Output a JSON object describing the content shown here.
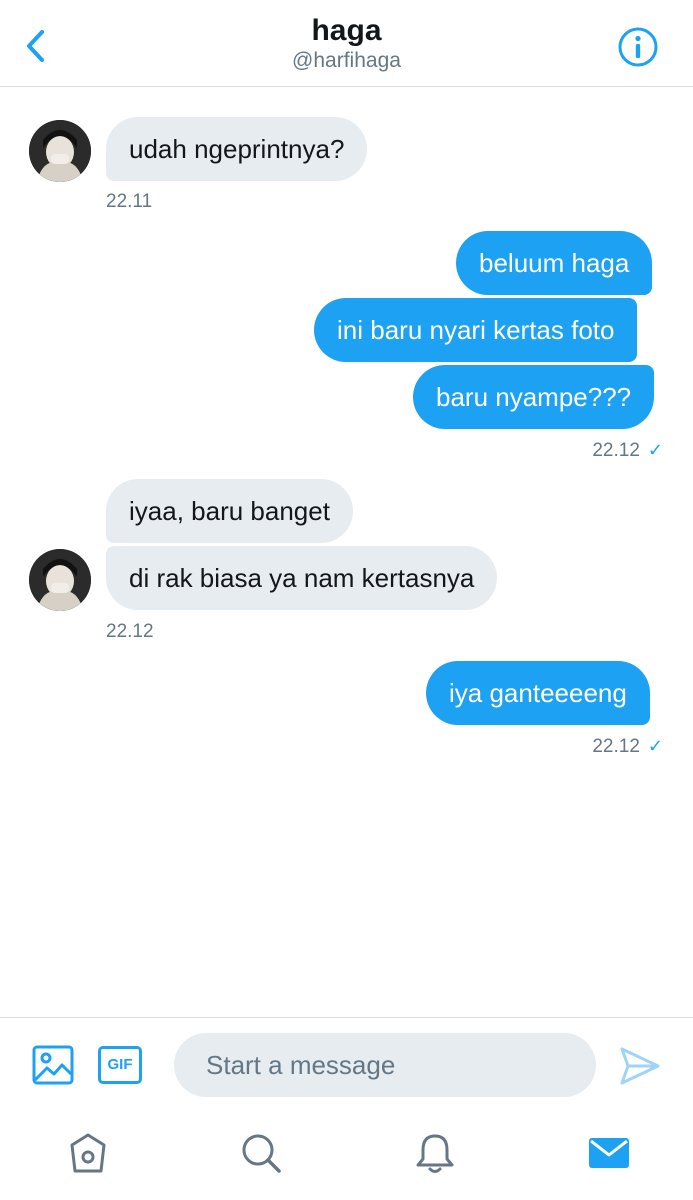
{
  "header": {
    "title": "haga",
    "handle": "@harfihaga",
    "back_icon": "chevron-left-icon",
    "info_icon": "info-icon"
  },
  "colors": {
    "accent": "#1da1f2",
    "incoming_bubble": "#e6ecf0",
    "muted_text": "#657786"
  },
  "messages": [
    {
      "sender": "other",
      "text": "udah ngeprintnya?"
    },
    {
      "sender": "other",
      "time": "22.11"
    },
    {
      "sender": "me",
      "text": "beluum haga"
    },
    {
      "sender": "me",
      "text": "ini baru nyari kertas foto"
    },
    {
      "sender": "me",
      "text": "baru nyampe???"
    },
    {
      "sender": "me",
      "time": "22.12",
      "status_icon": "check-icon"
    },
    {
      "sender": "other",
      "text": "iyaa, baru banget"
    },
    {
      "sender": "other",
      "text": "di rak biasa ya nam kertasnya"
    },
    {
      "sender": "other",
      "time": "22.12"
    },
    {
      "sender": "me",
      "text": "iya ganteeeeng"
    },
    {
      "sender": "me",
      "time": "22.12",
      "status_icon": "check-icon"
    }
  ],
  "composer": {
    "placeholder": "Start a message",
    "gif_label": "GIF",
    "media_icon": "image-icon",
    "send_icon": "send-icon"
  },
  "tabs": [
    {
      "icon": "home-icon",
      "active": false
    },
    {
      "icon": "search-icon",
      "active": false
    },
    {
      "icon": "bell-icon",
      "active": false
    },
    {
      "icon": "mail-icon",
      "active": true
    }
  ]
}
